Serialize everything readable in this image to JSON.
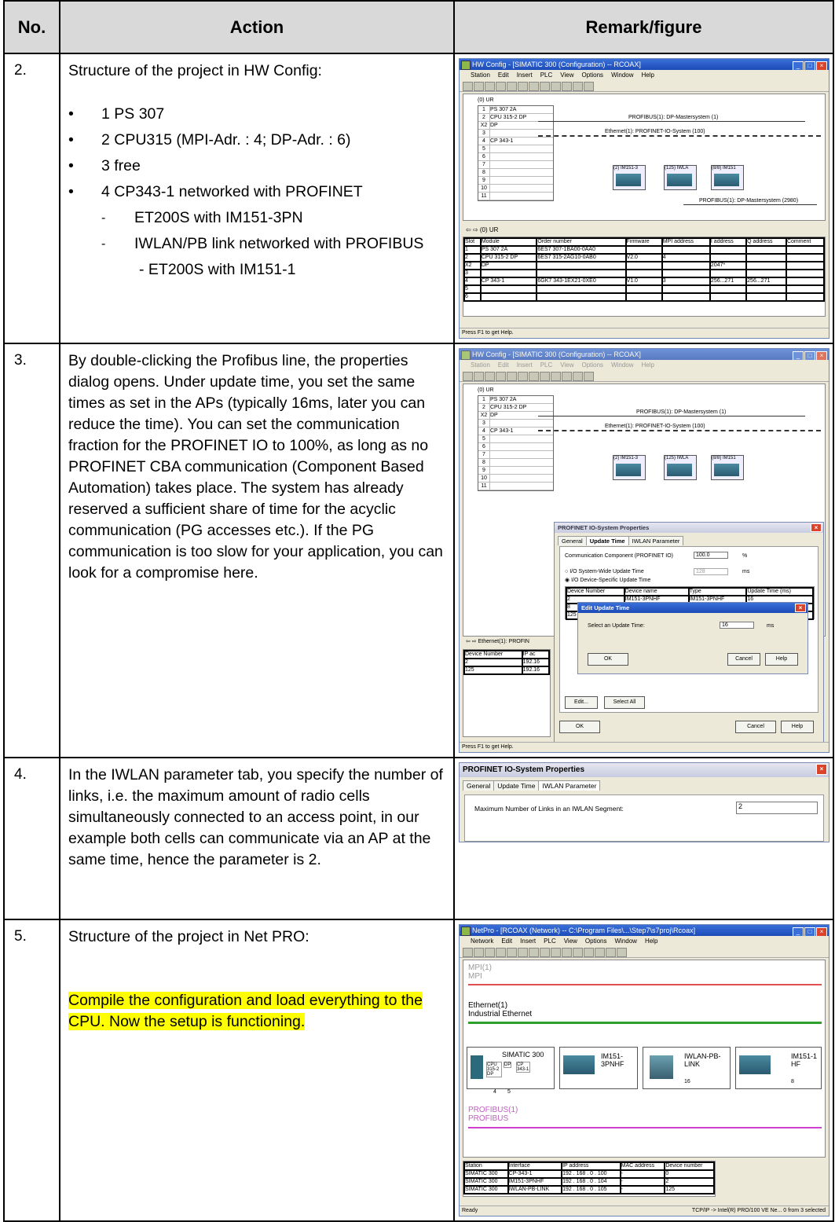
{
  "header": {
    "no": "No.",
    "action": "Action",
    "remark": "Remark/figure"
  },
  "rows": [
    {
      "no": "2.",
      "intro": "Structure of the project in HW Config:",
      "bullets": [
        "1 PS 307",
        "2 CPU315 (MPI-Adr. : 4; DP-Adr. : 6)",
        "3 free",
        "4 CP343-1 networked with PROFINET"
      ],
      "sub": [
        "ET200S with IM151-3PN",
        "IWLAN/PB link networked with PROFIBUS"
      ],
      "subsub": "- ET200S with IM151-1"
    },
    {
      "no": "3.",
      "text": "By double-clicking the Profibus line, the properties dialog opens. Under update time, you set the same times as set in the APs (typically 16ms, later you can reduce the time). You can set the communication fraction for the PROFINET IO to 100%, as long as no PROFINET CBA communication (Component Based Automation) takes place. The system has already reserved a sufficient share of time for the acyclic communication (PG accesses etc.). If the PG communication is too slow for your application, you can look for a compromise here."
    },
    {
      "no": "4.",
      "text": "In the IWLAN parameter tab, you specify the number of links, i.e. the maximum amount of radio cells simultaneously connected to an access point, in our example both cells can communicate via an AP at the same time, hence the parameter is 2."
    },
    {
      "no": "5.",
      "intro": "Structure of the project in Net PRO:",
      "highlight": "Compile the configuration and load everything to the CPU. Now the setup is functioning."
    }
  ],
  "fig1": {
    "title": "HW Config - [SIMATIC 300 (Configuration) -- RCOAX]",
    "menu": [
      "Station",
      "Edit",
      "Insert",
      "PLC",
      "View",
      "Options",
      "Window",
      "Help"
    ],
    "rack_title": "(0) UR",
    "rack": [
      {
        "slot": "1",
        "name": "PS 307 2A"
      },
      {
        "slot": "2",
        "name": "CPU 315-2 DP"
      },
      {
        "slot": "X2",
        "name": "DP"
      },
      {
        "slot": "3",
        "name": ""
      },
      {
        "slot": "4",
        "name": "CP 343-1"
      },
      {
        "slot": "5",
        "name": ""
      },
      {
        "slot": "6",
        "name": ""
      },
      {
        "slot": "7",
        "name": ""
      },
      {
        "slot": "8",
        "name": ""
      },
      {
        "slot": "9",
        "name": ""
      },
      {
        "slot": "10",
        "name": ""
      },
      {
        "slot": "11",
        "name": ""
      }
    ],
    "net_dp": "PROFIBUS(1): DP-Mastersystem (1)",
    "net_eth": "Ethernet(1): PROFINET-IO-System (100)",
    "net_dp2": "PROFIBUS(1): DP-Mastersystem (2980)",
    "devices": [
      "(2) IM151-3",
      "(125) IWLA",
      "(8/8) IM151"
    ],
    "grid_title": "(0) UR",
    "grid_cols": [
      "Slot",
      "Module",
      "Order number",
      "Firmware",
      "MPI address",
      "I address",
      "Q address",
      "Comment"
    ],
    "grid_rows": [
      [
        "1",
        "PS 307 2A",
        "6ES7 307-1BA00-0AA0",
        "",
        "",
        "",
        "",
        ""
      ],
      [
        "2",
        "CPU 315-2 DP",
        "6ES7 315-2AG10-0AB0",
        "V2.0",
        "4",
        "",
        "",
        ""
      ],
      [
        "X2",
        "DP",
        "",
        "",
        "",
        "2047*",
        "",
        ""
      ],
      [
        "3",
        "",
        "",
        "",
        "",
        "",
        "",
        ""
      ],
      [
        "4",
        "CP 343-1",
        "6GK7 343-1EX21-0XE0",
        "V1.0",
        "3",
        "256...271",
        "256...271",
        ""
      ],
      [
        "5",
        "",
        "",
        "",
        "",
        "",
        "",
        ""
      ],
      [
        "6",
        "",
        "",
        "",
        "",
        "",
        "",
        ""
      ]
    ],
    "status": "Press F1 to get Help."
  },
  "fig2": {
    "title": "HW Config - [SIMATIC 300 (Configuration) -- RCOAX]",
    "dlg_title": "PROFINET IO-System Properties",
    "tabs": [
      "General",
      "Update Time",
      "IWLAN Parameter"
    ],
    "comm_label": "Communication Component (PROFINET IO)",
    "comm_value": "100.0",
    "comm_unit": "%",
    "opt1": "I/O System-Wide Update Time",
    "opt1_val": "128",
    "opt2": "I/O Device-Specific Update Time",
    "ms": "ms",
    "list_cols": [
      "Device Number",
      "Device name",
      "Type",
      "Update Time (ms)"
    ],
    "list_rows": [
      [
        "2",
        "IM151-3PNHF",
        "IM151-3PNHF",
        "16"
      ],
      [
        "8",
        "IWLAN-PB-LINK/",
        "",
        "16"
      ],
      [
        "125",
        "IWLAN-PB-LINK",
        "IWLAN/PB Link",
        "16*"
      ]
    ],
    "sub_title": "Edit Update Time",
    "sub_label": "Select an Update Time:",
    "sub_value": "16",
    "ok": "OK",
    "cancel": "Cancel",
    "help": "Help",
    "edit": "Edit...",
    "select_all": "Select All",
    "eth_label": "Ethernet(1): PROFIN",
    "dev_col": "Device Number",
    "ip_col": "IP ac",
    "dev_rows": [
      [
        "2",
        "192.16"
      ],
      [
        "125",
        "192.16"
      ]
    ],
    "status": "Press F1 to get Help."
  },
  "fig3": {
    "title": "PROFINET IO-System Properties",
    "tabs": [
      "General",
      "Update Time",
      "IWLAN Parameter"
    ],
    "label": "Maximum Number of Links in an IWLAN Segment:",
    "value": "2"
  },
  "fig4": {
    "title": "NetPro - [RCOAX (Network) -- C:\\Program Files\\...\\Step7\\s7proj\\Rcoax]",
    "menu": [
      "Network",
      "Edit",
      "Insert",
      "PLC",
      "View",
      "Options",
      "Window",
      "Help"
    ],
    "mpi1": "MPI(1)",
    "mpi2": "MPI",
    "eth1": "Ethernet(1)",
    "eth2": "Industrial Ethernet",
    "station": "SIMATIC 300",
    "mods": [
      "CPU 315-2 DP",
      "DP",
      "CP 343-1"
    ],
    "n4": "4",
    "n5": "5",
    "dev2": "IM151-3PNHF",
    "dev3": "IWLAN-PB-LINK",
    "dev3n": "16",
    "dev4": "IM151-1 HF",
    "dev4n": "8",
    "pb1": "PROFIBUS(1)",
    "pb2": "PROFIBUS",
    "grid_cols": [
      "Station",
      "Interface",
      "IP address",
      "MAC address",
      "Device number"
    ],
    "grid_rows": [
      [
        "SIMATIC 300",
        "CP-343-1",
        "192 . 168 . 0 . 100",
        "-",
        "0"
      ],
      [
        "SIMATIC 300",
        "IM151-3PNHF",
        "192 . 168 . 0 . 104",
        "-",
        "2"
      ],
      [
        "SIMATIC 300",
        "IWLAN-PB-LINK",
        "192 . 168 . 0 . 105",
        "-",
        "125"
      ]
    ],
    "status": "Ready",
    "status2": "TCP/IP -> Intel(R) PRO/100 VE Ne...   0 from 3 selected"
  }
}
